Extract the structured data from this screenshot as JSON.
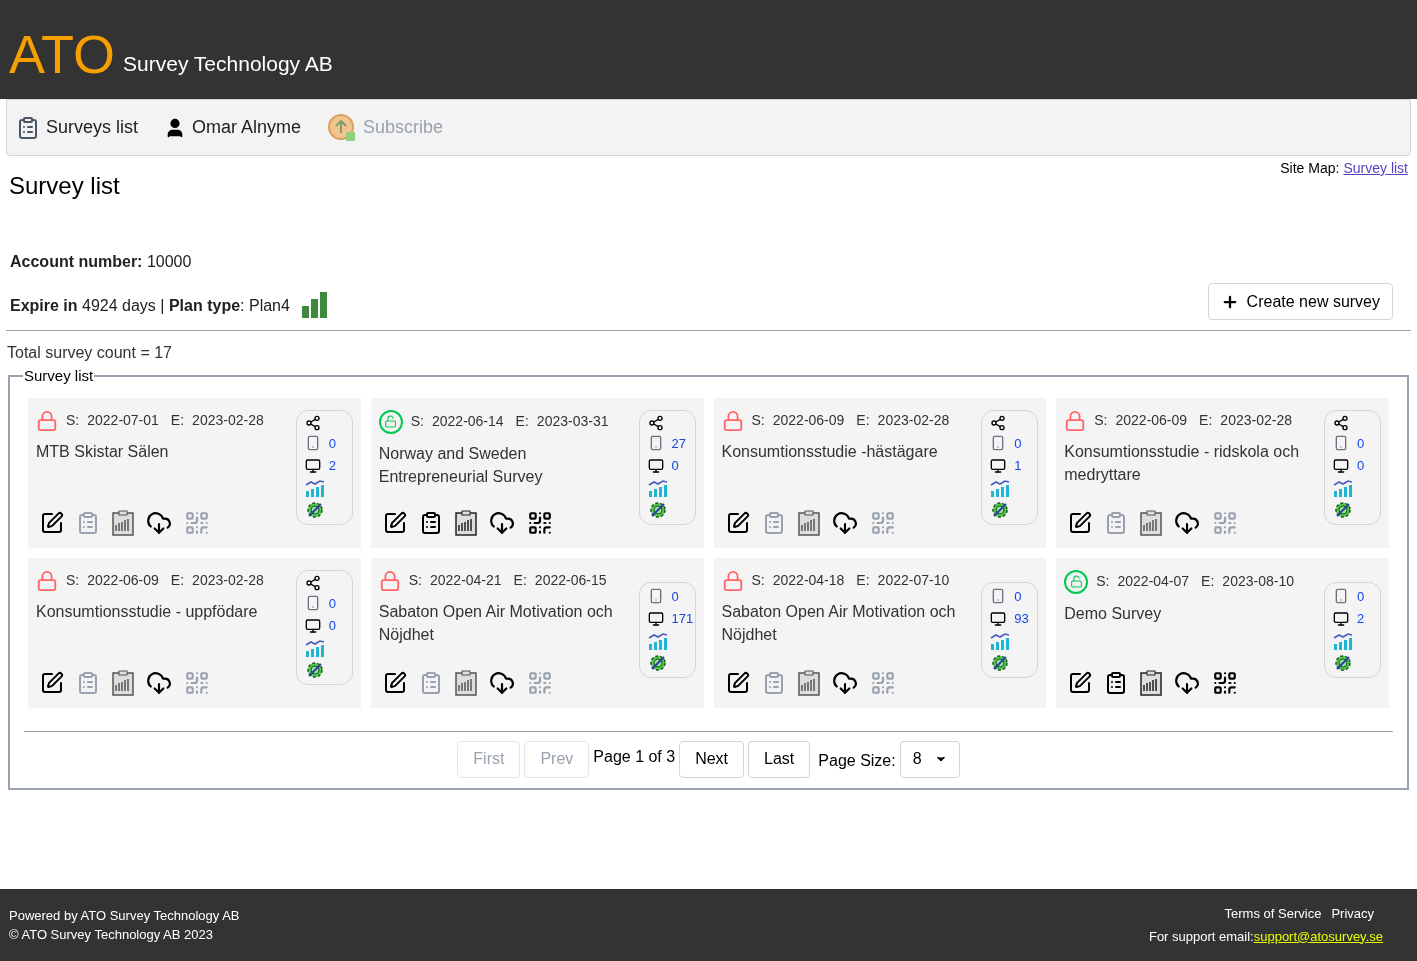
{
  "header": {
    "logo": "ATO",
    "company": "Survey Technology AB"
  },
  "nav": [
    {
      "kind": "surveys",
      "label": "Surveys list",
      "disabled": false
    },
    {
      "kind": "user",
      "label": "Omar Alnyme",
      "disabled": false
    },
    {
      "kind": "subscribe",
      "label": "Subscribe",
      "disabled": true
    }
  ],
  "page_title": "Survey list",
  "site_map": {
    "label": "Site Map:",
    "link": "Survey list"
  },
  "account": {
    "number_label": "Account number:",
    "number": "10000",
    "expire_label": "Expire in",
    "expire": "4924 days",
    "separator": "|",
    "plan_label": "Plan type",
    "plan_colon": ":",
    "plan": "Plan4"
  },
  "create_button": "Create new survey",
  "total": "Total survey count = 17",
  "legend": "Survey list",
  "surveys": [
    {
      "locked": true,
      "shared": true,
      "active": false,
      "s_label": "S:",
      "start": "2022-07-01",
      "e_label": "E:",
      "end": "2023-02-28",
      "title": "MTB Skistar Sälen",
      "mobile": "0",
      "desktop": "2"
    },
    {
      "locked": false,
      "shared": true,
      "active": true,
      "s_label": "S:",
      "start": "2022-06-14",
      "e_label": "E:",
      "end": "2023-03-31",
      "title": "Norway and Sweden Entrepreneurial Survey",
      "mobile": "27",
      "desktop": "0"
    },
    {
      "locked": true,
      "shared": true,
      "active": false,
      "s_label": "S:",
      "start": "2022-06-09",
      "e_label": "E:",
      "end": "2023-02-28",
      "title": "Konsumtionsstudie -hästägare",
      "mobile": "0",
      "desktop": "1"
    },
    {
      "locked": true,
      "shared": true,
      "active": false,
      "s_label": "S:",
      "start": "2022-06-09",
      "e_label": "E:",
      "end": "2023-02-28",
      "title": "Konsumtionsstudie - ridskola och medryttare",
      "mobile": "0",
      "desktop": "0"
    },
    {
      "locked": true,
      "shared": true,
      "active": false,
      "s_label": "S:",
      "start": "2022-06-09",
      "e_label": "E:",
      "end": "2023-02-28",
      "title": "Konsumtionsstudie - uppfödare",
      "mobile": "0",
      "desktop": "0"
    },
    {
      "locked": true,
      "shared": false,
      "active": false,
      "s_label": "S:",
      "start": "2022-04-21",
      "e_label": "E:",
      "end": "2022-06-15",
      "title": "Sabaton Open Air Motivation och Nöjdhet",
      "mobile": "0",
      "desktop": "171"
    },
    {
      "locked": true,
      "shared": false,
      "active": false,
      "s_label": "S:",
      "start": "2022-04-18",
      "e_label": "E:",
      "end": "2022-07-10",
      "title": "Sabaton Open Air Motivation och Nöjdhet",
      "mobile": "0",
      "desktop": "93"
    },
    {
      "locked": false,
      "shared": false,
      "active": true,
      "s_label": "S:",
      "start": "2022-04-07",
      "e_label": "E:",
      "end": "2023-08-10",
      "title": "Demo Survey",
      "mobile": "0",
      "desktop": "2"
    }
  ],
  "pagination": {
    "buttons": [
      {
        "label": "First",
        "disabled": true
      },
      {
        "label": "Prev",
        "disabled": true
      },
      {
        "label": "Next",
        "disabled": false
      },
      {
        "label": "Last",
        "disabled": false
      }
    ],
    "page_info": "Page 1 of 3",
    "size_label": "Page Size:",
    "size": "8"
  },
  "footer": {
    "powered": "Powered by ATO Survey Technology AB",
    "copyright": "© ATO Survey Technology AB 2023",
    "links": [
      "Terms of Service",
      "Privacy"
    ],
    "support_label": "For support email:",
    "support_email": "support@atosurvey.se"
  }
}
